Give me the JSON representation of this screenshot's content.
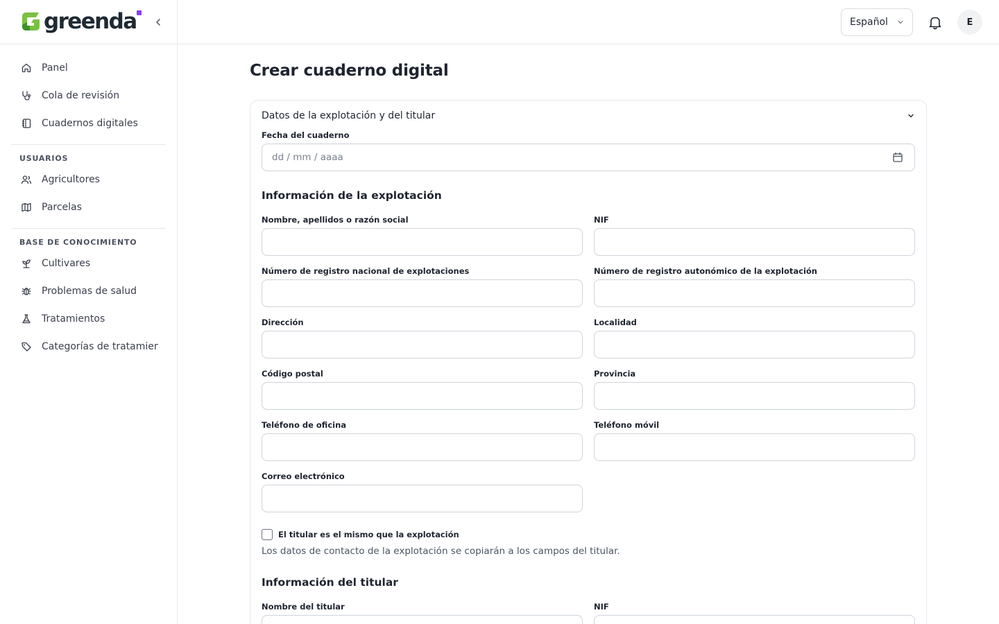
{
  "brand": {
    "name": "greenda",
    "accent_color": "#7ac143",
    "dot_color": "#8b3cf0"
  },
  "sidebar": {
    "collapse_icon": "chevron-left-icon",
    "items": [
      {
        "label": "Panel",
        "icon": "home-icon"
      },
      {
        "label": "Cola de revisión",
        "icon": "stethoscope-icon"
      },
      {
        "label": "Cuadernos digitales",
        "icon": "notebook-icon"
      }
    ],
    "sections": [
      {
        "title": "USUARIOS",
        "items": [
          {
            "label": "Agricultores",
            "icon": "users-icon"
          },
          {
            "label": "Parcelas",
            "icon": "map-icon"
          }
        ]
      },
      {
        "title": "BASE DE CONOCIMIENTO",
        "items": [
          {
            "label": "Cultivares",
            "icon": "sprout-icon"
          },
          {
            "label": "Problemas de salud",
            "icon": "bug-icon"
          },
          {
            "label": "Tratamientos",
            "icon": "flask-icon"
          },
          {
            "label": "Categorías de tratamien",
            "icon": "tag-icon"
          }
        ]
      }
    ]
  },
  "header": {
    "language": "Español",
    "notifications_icon": "bell-icon",
    "avatar_initial": "E"
  },
  "main": {
    "title": "Crear cuaderno digital",
    "accordion_title": "Datos de la explotación y del titular",
    "date_field": {
      "label": "Fecha del cuaderno",
      "placeholder": "dd / mm / aaaa"
    },
    "farm_section": {
      "title": "Información de la explotación",
      "fields": [
        {
          "label": "Nombre, apellidos o razón social",
          "value": ""
        },
        {
          "label": "NIF",
          "value": ""
        },
        {
          "label": "Número de registro nacional de explotaciones",
          "value": ""
        },
        {
          "label": "Número de registro autonómico de la explotación",
          "value": ""
        },
        {
          "label": "Dirección",
          "value": ""
        },
        {
          "label": "Localidad",
          "value": ""
        },
        {
          "label": "Código postal",
          "value": ""
        },
        {
          "label": "Provincia",
          "value": ""
        },
        {
          "label": "Teléfono de oficina",
          "value": ""
        },
        {
          "label": "Teléfono móvil",
          "value": ""
        },
        {
          "label": "Correo electrónico",
          "value": ""
        }
      ]
    },
    "same_owner": {
      "label": "El titular es el mismo que la explotación",
      "checked": false,
      "helper": "Los datos de contacto de la explotación se copiarán a los campos del titular."
    },
    "owner_section": {
      "title": "Información del titular",
      "fields": [
        {
          "label": "Nombre del titular",
          "value": ""
        },
        {
          "label": "NIF",
          "value": ""
        }
      ]
    }
  }
}
